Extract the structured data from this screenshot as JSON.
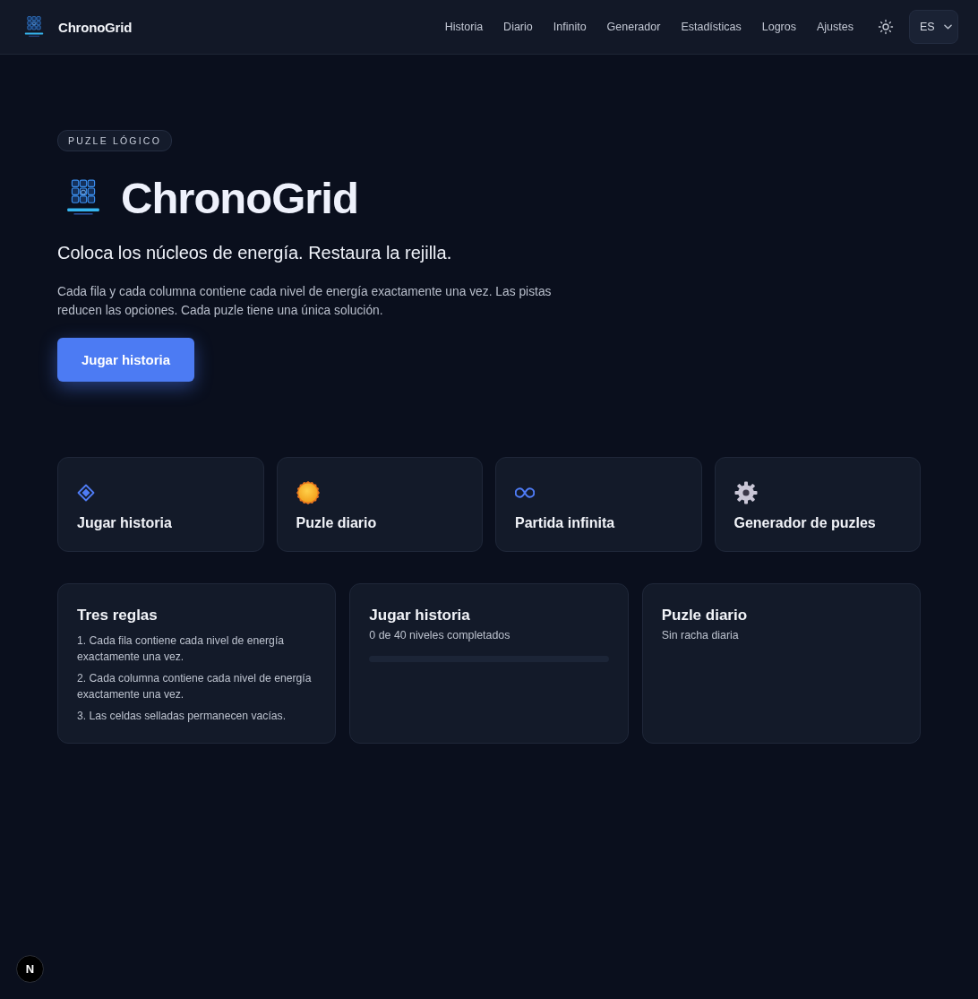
{
  "header": {
    "brand": "ChronoGrid",
    "nav": [
      {
        "label": "Historia"
      },
      {
        "label": "Diario"
      },
      {
        "label": "Infinito"
      },
      {
        "label": "Generador"
      },
      {
        "label": "Estadísticas"
      },
      {
        "label": "Logros"
      },
      {
        "label": "Ajustes"
      }
    ],
    "language": "ES"
  },
  "hero": {
    "badge": "PUZLE LÓGICO",
    "title": "ChronoGrid",
    "subtitle": "Coloca los núcleos de energía. Restaura la rejilla.",
    "description": "Cada fila y cada columna contiene cada nivel de energía exactamente una vez. Las pistas reducen las opciones. Cada puzle tiene una única solución.",
    "cta": "Jugar historia"
  },
  "modes": [
    {
      "kind": "diamond",
      "label": "Jugar historia"
    },
    {
      "kind": "sun",
      "label": "Puzle diario"
    },
    {
      "kind": "infinity",
      "label": "Partida infinita"
    },
    {
      "kind": "gear",
      "label": "Generador de puzles"
    }
  ],
  "panels": [
    {
      "kind": "rules",
      "title": "Tres reglas",
      "rules": [
        "1. Cada fila contiene cada nivel de energía exactamente una vez.",
        "2. Cada columna contiene cada nivel de energía exactamente una vez.",
        "3. Las celdas selladas permanecen vacías."
      ]
    },
    {
      "kind": "progress",
      "title": "Jugar historia",
      "text": "0 de 40 niveles completados"
    },
    {
      "kind": "streak",
      "title": "Puzle diario",
      "text": "Sin racha diaria"
    }
  ],
  "dev_badge": "N"
}
